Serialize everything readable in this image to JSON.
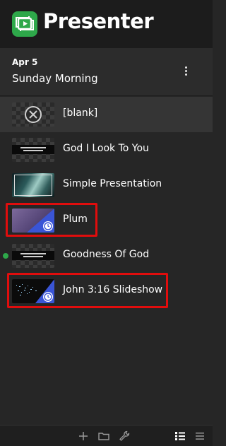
{
  "header": {
    "app_title": "Presenter",
    "logo_icon": "presenter-logo-icon",
    "brand_color": "#2ea84a"
  },
  "plan": {
    "date": "Apr 5",
    "name": "Sunday Morning",
    "menu_icon": "more-vertical-icon"
  },
  "items": [
    {
      "label": "[blank]",
      "thumb": "blank-circle-x",
      "active": true
    },
    {
      "label": "God I Look To You",
      "thumb": "lyrics-on-checker"
    },
    {
      "label": "Simple Presentation",
      "thumb": "ocean-photo"
    },
    {
      "label": "Plum",
      "thumb": "plum-gradient",
      "badge_icon": "clock-icon",
      "highlighted": true
    },
    {
      "label": "Goodness Of God",
      "thumb": "lyrics-on-checker",
      "live_indicator": "green-dot"
    },
    {
      "label": "John 3:16 Slideshow",
      "thumb": "starry-text",
      "badge_icon": "clock-icon",
      "highlighted": true
    }
  ],
  "footer": {
    "icons": [
      "add-icon",
      "folder-icon",
      "wrench-icon",
      "detailed-list-view-icon",
      "compact-list-view-icon"
    ],
    "selected_view": "detailed-list-view-icon"
  },
  "colors": {
    "highlight": "#e00d0d",
    "live_dot": "#2ea84a",
    "badge_blue": "#3a55d6"
  }
}
